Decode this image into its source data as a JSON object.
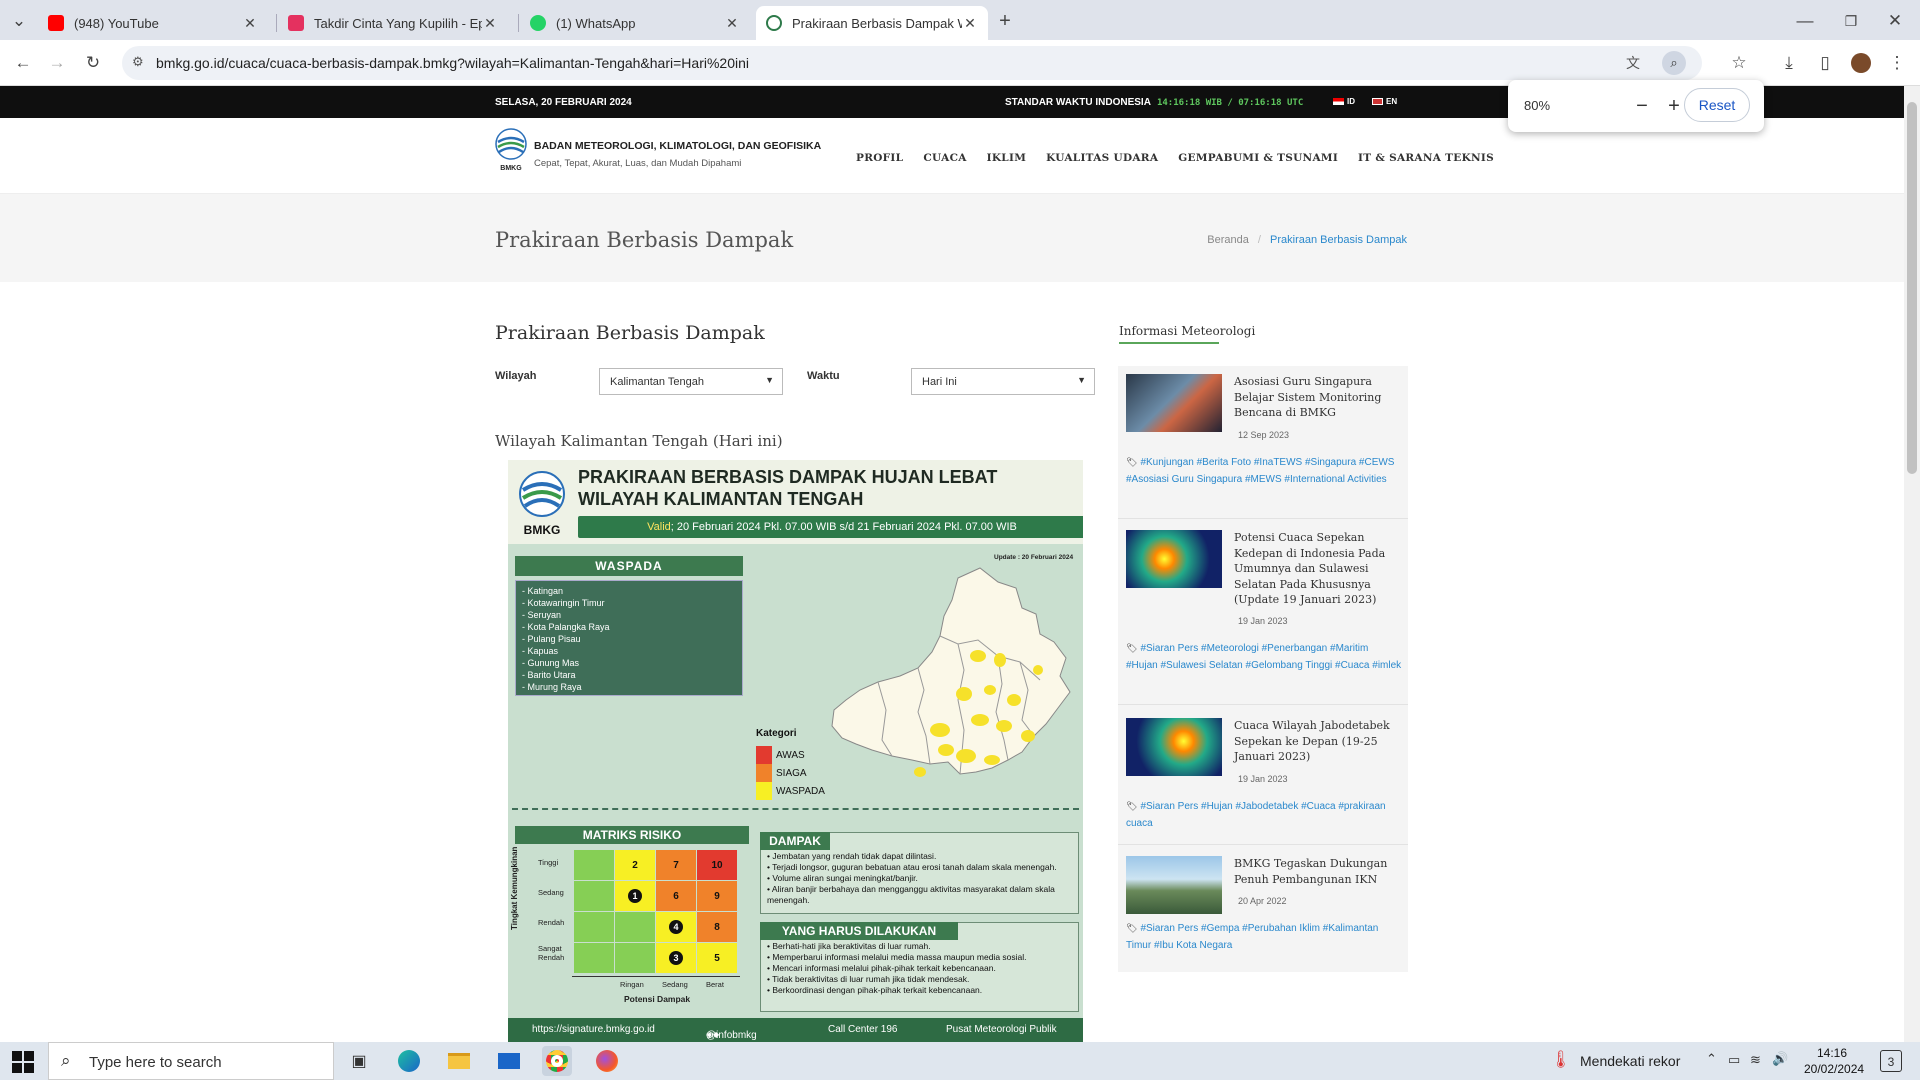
{
  "browser": {
    "tabs": [
      {
        "title": "(948) YouTube",
        "icon": "youtube-icon",
        "color": "#ff0000"
      },
      {
        "title": "Takdir Cinta Yang Kupilih - Episo",
        "icon": "vidio-icon",
        "color": "#e4315f"
      },
      {
        "title": "(1) WhatsApp",
        "icon": "whatsapp-icon",
        "color": "#25d366"
      },
      {
        "title": "Prakiraan Berbasis Dampak Wila",
        "icon": "bmkg-icon",
        "color": "#2e7a4a"
      }
    ],
    "url": "bmkg.go.id/cuaca/cuaca-berbasis-dampak.bmkg?wilayah=Kalimantan-Tengah&hari=Hari%20ini",
    "zoom": {
      "value": "80%",
      "minus": "−",
      "plus": "+",
      "reset": "Reset"
    }
  },
  "site": {
    "topbar": {
      "date": "SELASA, 20 FEBRUARI 2024",
      "time_label": "STANDAR WAKTU INDONESIA",
      "time": "14:16:18 WIB / 07:16:18 UTC",
      "lang_id": "ID",
      "lang_en": "EN"
    },
    "logo_text": "BMKG",
    "org": "BADAN METEOROLOGI, KLIMATOLOGI, DAN GEOFISIKA",
    "tagline": "Cepat, Tepat, Akurat, Luas, dan Mudah Dipahami",
    "nav": [
      "PROFIL",
      "CUACA",
      "IKLIM",
      "KUALITAS UDARA",
      "GEMPABUMI & TSUNAMI",
      "IT & SARANA TEKNIS"
    ],
    "band_title": "Prakiraan Berbasis Dampak",
    "breadcrumb": {
      "home": "Beranda",
      "sep": "/",
      "current": "Prakiraan Berbasis Dampak"
    }
  },
  "main": {
    "title": "Prakiraan Berbasis Dampak",
    "wilayah_label": "Wilayah",
    "wilayah_value": "Kalimantan Tengah",
    "waktu_label": "Waktu",
    "waktu_value": "Hari Ini",
    "subtitle": "Wilayah Kalimantan Tengah (Hari ini)"
  },
  "infographic": {
    "logo_text": "BMKG",
    "title": "PRAKIRAAN BERBASIS DAMPAK HUJAN LEBAT WILAYAH KALIMANTAN TENGAH",
    "valid_label": "Valid",
    "valid_text": "; 20 Februari 2024 Pkl. 07.00 WIB s/d 21 Februari 2024 Pkl. 07.00 WIB",
    "update": "Update : 20 Februari 2024",
    "waspada_header": "WASPADA",
    "waspada_list": [
      "- Katingan",
      "- Kotawaringin Timur",
      "- Seruyan",
      "- Kota Palangka Raya",
      "- Pulang Pisau",
      "- Kapuas",
      "- Gunung Mas",
      "- Barito Utara",
      "- Murung Raya"
    ],
    "kategori_title": "Kategori",
    "kategori": [
      {
        "label": "AWAS",
        "color": "#e23a2f"
      },
      {
        "label": "SIAGA",
        "color": "#f0822a"
      },
      {
        "label": "WASPADA",
        "color": "#f7ef24"
      }
    ],
    "matrix_header": "MATRIKS RISIKO",
    "matrix_ylabel": "Tingkat Kemungkinan",
    "matrix_xlabel": "Potensi Dampak",
    "matrix_rows": [
      "Tinggi",
      "Sedang",
      "Rendah",
      "Sangat Rendah"
    ],
    "matrix_cols": [
      "Ringan",
      "Sedang",
      "Berat"
    ],
    "matrix_cells": [
      [
        "",
        "2",
        "7",
        "10"
      ],
      [
        "",
        "1",
        "6",
        "9"
      ],
      [
        "",
        "",
        "4",
        "8"
      ],
      [
        "",
        "",
        "3",
        "5"
      ]
    ],
    "dampak_header": "DAMPAK",
    "dampak_list": [
      "• Jembatan yang rendah tidak dapat dilintasi.",
      "• Terjadi longsor, guguran bebatuan atau erosi tanah dalam skala menengah.",
      "• Volume aliran sungai meningkat/banjir.",
      "• Aliran banjir berbahaya dan mengganggu aktivitas masyarakat dalam skala menengah."
    ],
    "harus_header": "YANG HARUS DILAKUKAN",
    "harus_list": [
      "• Berhati-hati jika beraktivitas di luar rumah.",
      "• Memperbarui informasi melalui media massa maupun media sosial.",
      "• Mencari informasi melalui pihak-pihak terkait kebencanaan.",
      "• Tidak beraktivitas di luar rumah jika tidak mendesak.",
      "• Berkoordinasi dengan pihak-pihak terkait kebencanaan."
    ],
    "footer": [
      "https://signature.bmkg.go.id",
      "@infobmkg",
      "Call Center 196",
      "Pusat Meteorologi Publik"
    ]
  },
  "sidebar": {
    "title": "Informasi Meteorologi",
    "news": [
      {
        "title": "Asosiasi Guru Singapura Belajar Sistem Monitoring Bencana di BMKG",
        "date": "12 Sep 2023",
        "tags": "#Kunjungan #Berita Foto #InaTEWS #Singapura #CEWS #Asosiasi Guru Singapura #MEWS #International Activities"
      },
      {
        "title": "Potensi Cuaca Sepekan Kedepan di Indonesia Pada Umumnya dan Sulawesi Selatan Pada Khususnya (Update 19 Januari 2023)",
        "date": "19 Jan 2023",
        "tags": "#Siaran Pers #Meteorologi #Penerbangan #Maritim #Hujan #Sulawesi Selatan #Gelombang Tinggi #Cuaca #imlek"
      },
      {
        "title": "Cuaca Wilayah Jabodetabek Sepekan ke Depan (19-25 Januari 2023)",
        "date": "19 Jan 2023",
        "tags": "#Siaran Pers #Hujan #Jabodetabek #Cuaca #prakiraan cuaca"
      },
      {
        "title": "BMKG Tegaskan Dukungan Penuh Pembangunan IKN",
        "date": "20 Apr 2022",
        "tags": "#Siaran Pers #Gempa #Perubahan Iklim #Kalimantan Timur #Ibu Kota Negara"
      }
    ]
  },
  "taskbar": {
    "search_placeholder": "Type here to search",
    "weather": "Mendekati rekor",
    "time": "14:16",
    "date": "20/02/2024",
    "notif": "3"
  }
}
